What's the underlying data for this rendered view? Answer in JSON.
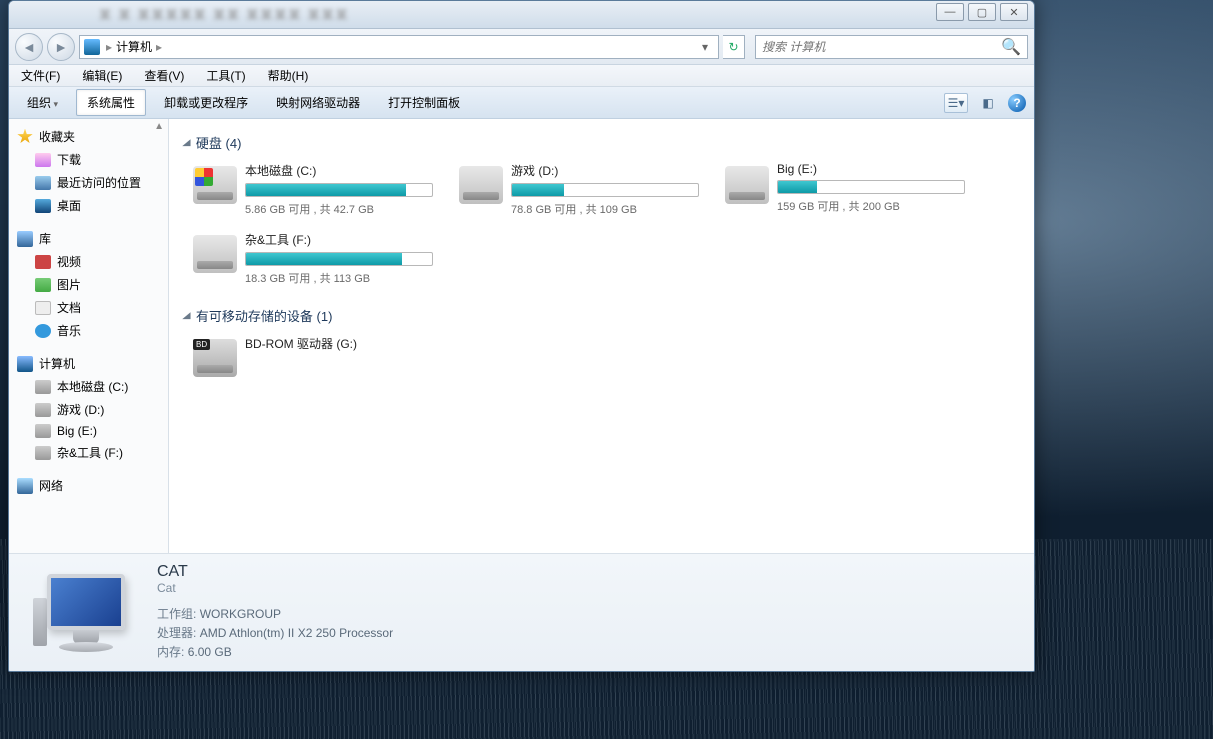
{
  "window": {
    "title_blur": "某 某 某某某某某  某某 某某某某  某某某",
    "controls": {
      "min": "—",
      "max": "▢",
      "close": "✕"
    }
  },
  "nav": {
    "back": "◄",
    "fwd": "►",
    "path_label": "计算机",
    "path_sep": "▸",
    "dropdown": "▾",
    "refresh": "↻"
  },
  "search": {
    "placeholder": "搜索 计算机",
    "icon": "🔍"
  },
  "menu": {
    "file": "文件(F)",
    "edit": "编辑(E)",
    "view": "查看(V)",
    "tools": "工具(T)",
    "help": "帮助(H)"
  },
  "toolbar": {
    "organize": "组织",
    "properties": "系统属性",
    "uninstall": "卸载或更改程序",
    "mapdrive": "映射网络驱动器",
    "controlpanel": "打开控制面板",
    "help": "?"
  },
  "sidebar": {
    "fav": "收藏夹",
    "downloads": "下载",
    "recent": "最近访问的位置",
    "desktop": "桌面",
    "libraries": "库",
    "videos": "视频",
    "pictures": "图片",
    "documents": "文档",
    "music": "音乐",
    "computer": "计算机",
    "c": "本地磁盘 (C:)",
    "d": "游戏 (D:)",
    "e": "Big (E:)",
    "f": "杂&工具 (F:)",
    "network": "网络"
  },
  "groups": {
    "hdd": "硬盘 (4)",
    "removable": "有可移动存储的设备 (1)"
  },
  "drives": [
    {
      "name": "本地磁盘 (C:)",
      "stat": "5.86 GB 可用 , 共 42.7 GB",
      "fill": 86,
      "sys": true
    },
    {
      "name": "游戏 (D:)",
      "stat": "78.8 GB 可用 , 共 109 GB",
      "fill": 28,
      "sys": false
    },
    {
      "name": "Big (E:)",
      "stat": "159 GB 可用 , 共 200 GB",
      "fill": 21,
      "sys": false
    },
    {
      "name": "杂&工具 (F:)",
      "stat": "18.3 GB 可用 , 共 113 GB",
      "fill": 84,
      "sys": false
    }
  ],
  "optical": {
    "name": "BD-ROM 驱动器 (G:)"
  },
  "details": {
    "name": "CAT",
    "sub": "Cat",
    "workgroup_label": "工作组:",
    "workgroup": "WORKGROUP",
    "cpu_label": "处理器:",
    "cpu": "AMD Athlon(tm) II X2 250 Processor",
    "mem_label": "内存:",
    "mem": "6.00 GB"
  }
}
